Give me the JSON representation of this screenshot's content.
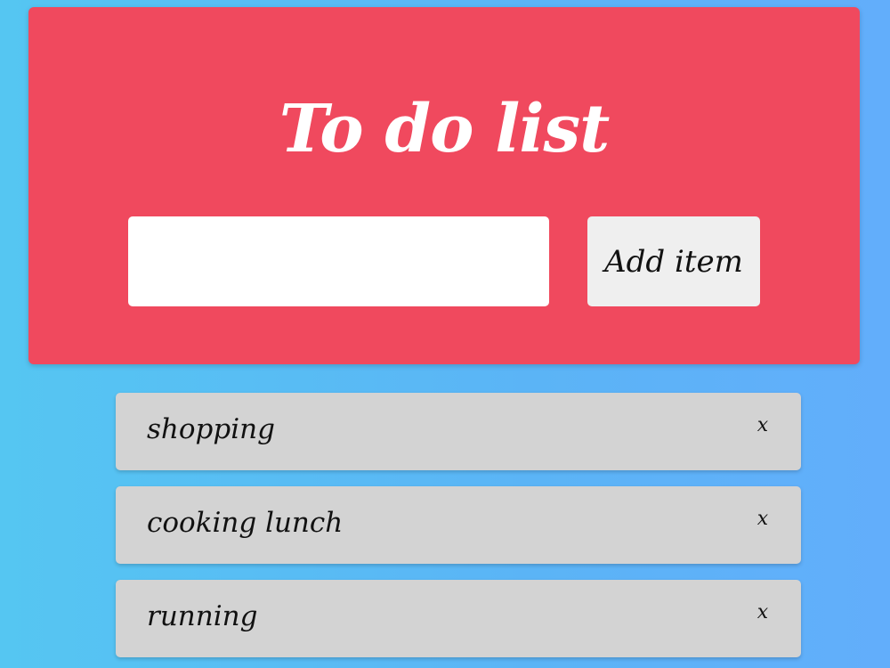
{
  "header": {
    "title": "To do list",
    "input_value": "",
    "input_placeholder": "",
    "add_button_label": "Add item"
  },
  "todos": [
    {
      "label": "shopping",
      "delete_label": "x"
    },
    {
      "label": "cooking lunch",
      "delete_label": "x"
    },
    {
      "label": "running",
      "delete_label": "x"
    }
  ],
  "colors": {
    "header_background": "#f0495e",
    "page_gradient_start": "#55c6f2",
    "page_gradient_end": "#62aefb",
    "item_background": "#d3d3d3",
    "button_background": "#efefef",
    "title_text": "#ffffff"
  }
}
